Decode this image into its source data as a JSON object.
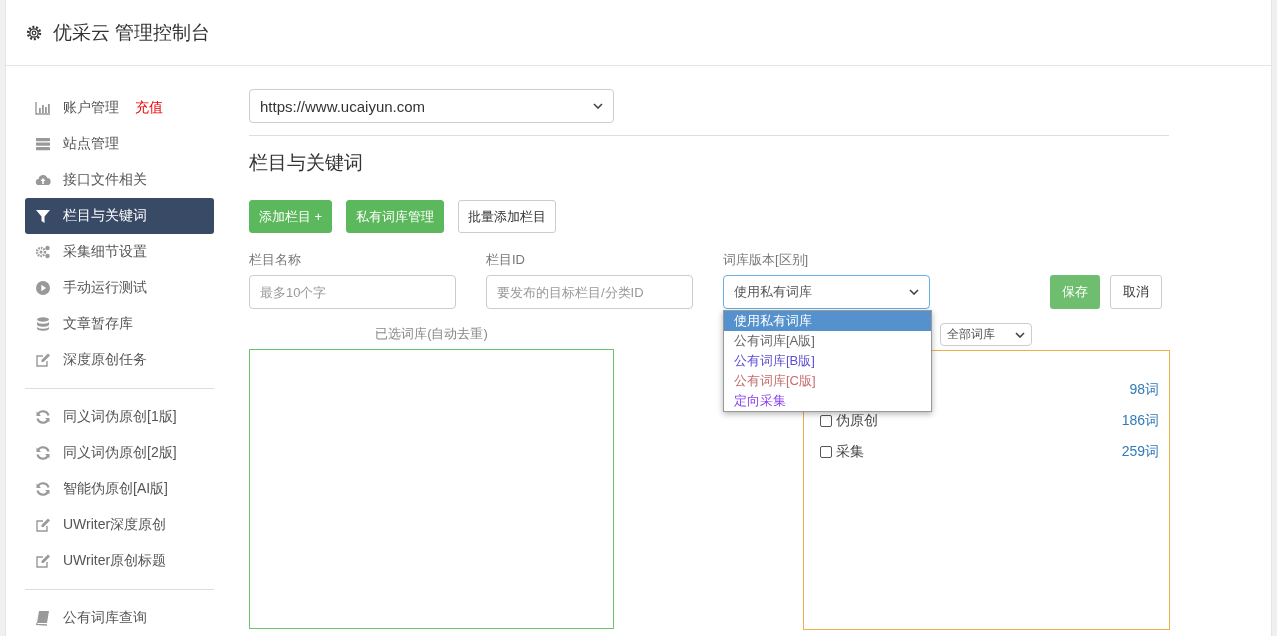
{
  "header": {
    "title": "优采云 管理控制台"
  },
  "sidebar": {
    "groups": [
      [
        {
          "label": "账户管理",
          "badge": "充值",
          "selected": false
        },
        {
          "label": "站点管理",
          "selected": false
        },
        {
          "label": "接口文件相关",
          "selected": false
        },
        {
          "label": "栏目与关键词",
          "selected": true
        },
        {
          "label": "采集细节设置",
          "selected": false
        },
        {
          "label": "手动运行测试",
          "selected": false
        },
        {
          "label": "文章暂存库",
          "selected": false
        },
        {
          "label": "深度原创任务",
          "selected": false
        }
      ],
      [
        {
          "label": "同义词伪原创[1版]",
          "selected": false
        },
        {
          "label": "同义词伪原创[2版]",
          "selected": false
        },
        {
          "label": "智能伪原创[AI版]",
          "selected": false
        },
        {
          "label": "UWriter深度原创",
          "selected": false
        },
        {
          "label": "UWriter原创标题",
          "selected": false
        }
      ],
      [
        {
          "label": "公有词库查询",
          "selected": false
        }
      ]
    ]
  },
  "site_select": {
    "value": "https://www.ucaiyun.com"
  },
  "section_title": "栏目与关键词",
  "actions": [
    {
      "label": "添加栏目 +",
      "kind": "primary"
    },
    {
      "label": "私有词库管理",
      "kind": "primary"
    },
    {
      "label": "批量添加栏目",
      "kind": "default"
    }
  ],
  "form": {
    "fields": [
      {
        "label": "栏目名称",
        "placeholder": "最多10个字"
      },
      {
        "label": "栏目ID",
        "placeholder": "要发布的目标栏目/分类ID"
      }
    ],
    "library": {
      "label": "词库版本[区别]",
      "value": "使用私有词库",
      "options": [
        {
          "label": "使用私有词库",
          "selected": true
        },
        {
          "label": "公有词库[A版]",
          "color": "#666666",
          "selected": false
        },
        {
          "label": "公有词库[B版]",
          "color": "#5b4fd6",
          "selected": false
        },
        {
          "label": "公有词库[C版]",
          "color": "#c76b6b",
          "selected": false
        },
        {
          "label": "定向采集",
          "color": "#8a3ff0",
          "selected": false
        }
      ]
    },
    "save": "保存",
    "cancel": "取消"
  },
  "selected_label": "已选词库(自动去重)",
  "filter_select": {
    "value": "全部词库"
  },
  "libraries": [
    {
      "count": "98词"
    },
    {
      "label": "伪原创",
      "count": "186词",
      "checked": false
    },
    {
      "label": "采集",
      "count": "259词",
      "checked": false
    }
  ]
}
